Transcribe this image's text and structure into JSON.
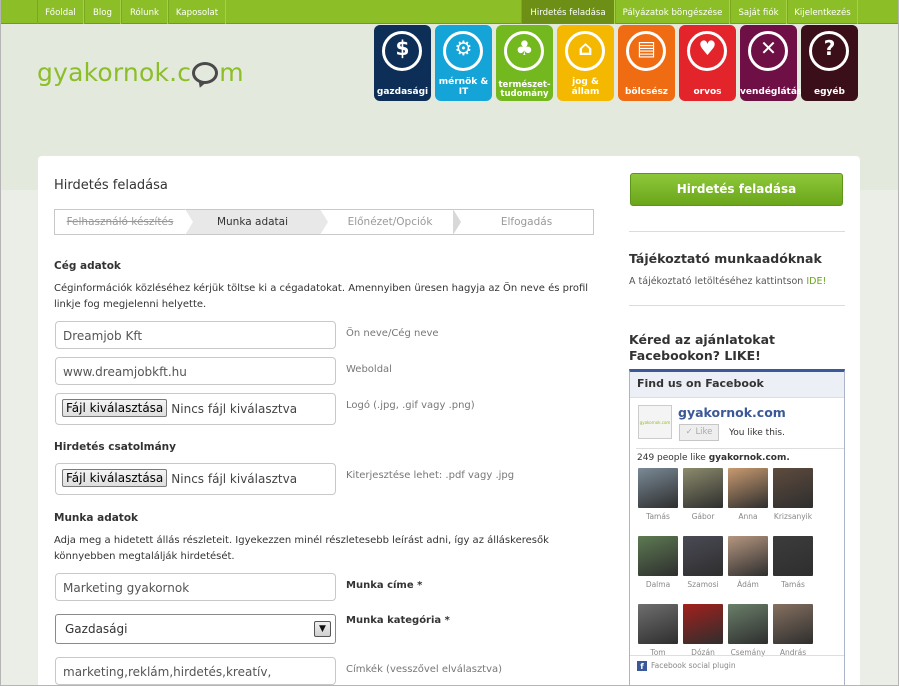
{
  "topnav": {
    "left": [
      "Főoldal",
      "Blog",
      "Rólunk",
      "Kaposolat"
    ],
    "right": [
      "Hirdetés feladása",
      "Pályázatok böngészése",
      "Saját fiók",
      "Kijelentkezés"
    ]
  },
  "brand": {
    "logo_before": "gyakornok.c",
    "logo_after": "m"
  },
  "categories": [
    {
      "label": "gazdasági",
      "color": "#0d2f57",
      "icon": "dollar-icon",
      "glyph": "$"
    },
    {
      "label": "mérnök & IT",
      "color": "#15a4d8",
      "icon": "gear-icon",
      "glyph": "⚙"
    },
    {
      "label": "természet-\ntudomány",
      "color": "#74b81f",
      "icon": "tree-icon",
      "glyph": "♣"
    },
    {
      "label": "jog & állam",
      "color": "#f4b800",
      "icon": "columns-icon",
      "glyph": "⌂"
    },
    {
      "label": "bölcsész",
      "color": "#ef6c12",
      "icon": "book-icon",
      "glyph": "▤"
    },
    {
      "label": "orvos",
      "color": "#e3242b",
      "icon": "heart-cross-icon",
      "glyph": "♥"
    },
    {
      "label": "vendéglátás",
      "color": "#6e1046",
      "icon": "cutlery-icon",
      "glyph": "✕"
    },
    {
      "label": "egyéb",
      "color": "#3a0f1a",
      "icon": "question-icon",
      "glyph": "?"
    }
  ],
  "page": {
    "title": "Hirdetés feladása"
  },
  "steps": [
    "Felhasználó készítés",
    "Munka adatai",
    "Előnézet/Opciók",
    "Elfogadás"
  ],
  "company": {
    "heading": "Cég adatok",
    "description": "Céginformációk közléséhez kérjük töltse ki a cégadatokat. Amennyiben üresen hagyja az Ön neve és profil linkje fog megjelenni helyette.",
    "name_value": "Dreamjob Kft",
    "name_hint": "Ön neve/Cég neve",
    "web_value": "www.dreamjobkft.hu",
    "web_hint": "Weboldal",
    "file_button": "Fájl kiválasztása",
    "file_none": "Nincs fájl kiválasztva",
    "logo_hint": "Logó (.jpg, .gif vagy .png)"
  },
  "attachment": {
    "heading": "Hirdetés csatolmány",
    "file_button": "Fájl kiválasztása",
    "file_none": "Nincs fájl kiválasztva",
    "hint": "Kiterjesztése lehet: .pdf vagy .jpg"
  },
  "job": {
    "heading": "Munka adatok",
    "description": "Adja meg a hidetett állás részleteit. Igyekezzen minél részletesebb leírást adni, így az álláskeresők könnyebben megtalálják hirdetését.",
    "title_value": "Marketing gyakornok",
    "title_label": "Munka címe *",
    "category_value": "Gazdasági",
    "category_label": "Munka kategória *",
    "tags_value": "marketing,reklám,hirdetés,kreatív,",
    "tags_hint": "Címkék (vesszővel elválasztva)"
  },
  "sidebar": {
    "cta": "Hirdetés feladása",
    "info_heading": "Tájékoztató munkaadóknak",
    "info_text": "A tájékoztató letöltéséhez kattintson",
    "info_link": "IDE!",
    "fb_heading_1": "Kéred az ajánlatokat",
    "fb_heading_2": "Facebookon? LIKE!"
  },
  "facebook": {
    "box_title": "Find us on Facebook",
    "page_name": "gyakornok.com",
    "logo_text": "gyakornok.com",
    "like_label": "Like",
    "you_like": "You like this.",
    "count_prefix": "249 people like",
    "count_page": "gyakornok.com.",
    "fans": [
      {
        "name": "Tamás",
        "color": "#7a8a96"
      },
      {
        "name": "Gábor",
        "color": "#8c8b6c"
      },
      {
        "name": "Anna",
        "color": "#c89a70"
      },
      {
        "name": "Krizsanyik",
        "color": "#5e4b3e"
      },
      {
        "name": "Dalma",
        "color": "#5d7a52"
      },
      {
        "name": "Szamosi",
        "color": "#4a4a55"
      },
      {
        "name": "Ádám",
        "color": "#b59680"
      },
      {
        "name": "Tamás",
        "color": "#3c3c3c"
      },
      {
        "name": "Tom",
        "color": "#6e6e6e"
      },
      {
        "name": "Dózán",
        "color": "#a3201c"
      },
      {
        "name": "Csemány",
        "color": "#6a7f6a"
      },
      {
        "name": "András",
        "color": "#857060"
      }
    ],
    "plugin": "Facebook social plugin"
  }
}
